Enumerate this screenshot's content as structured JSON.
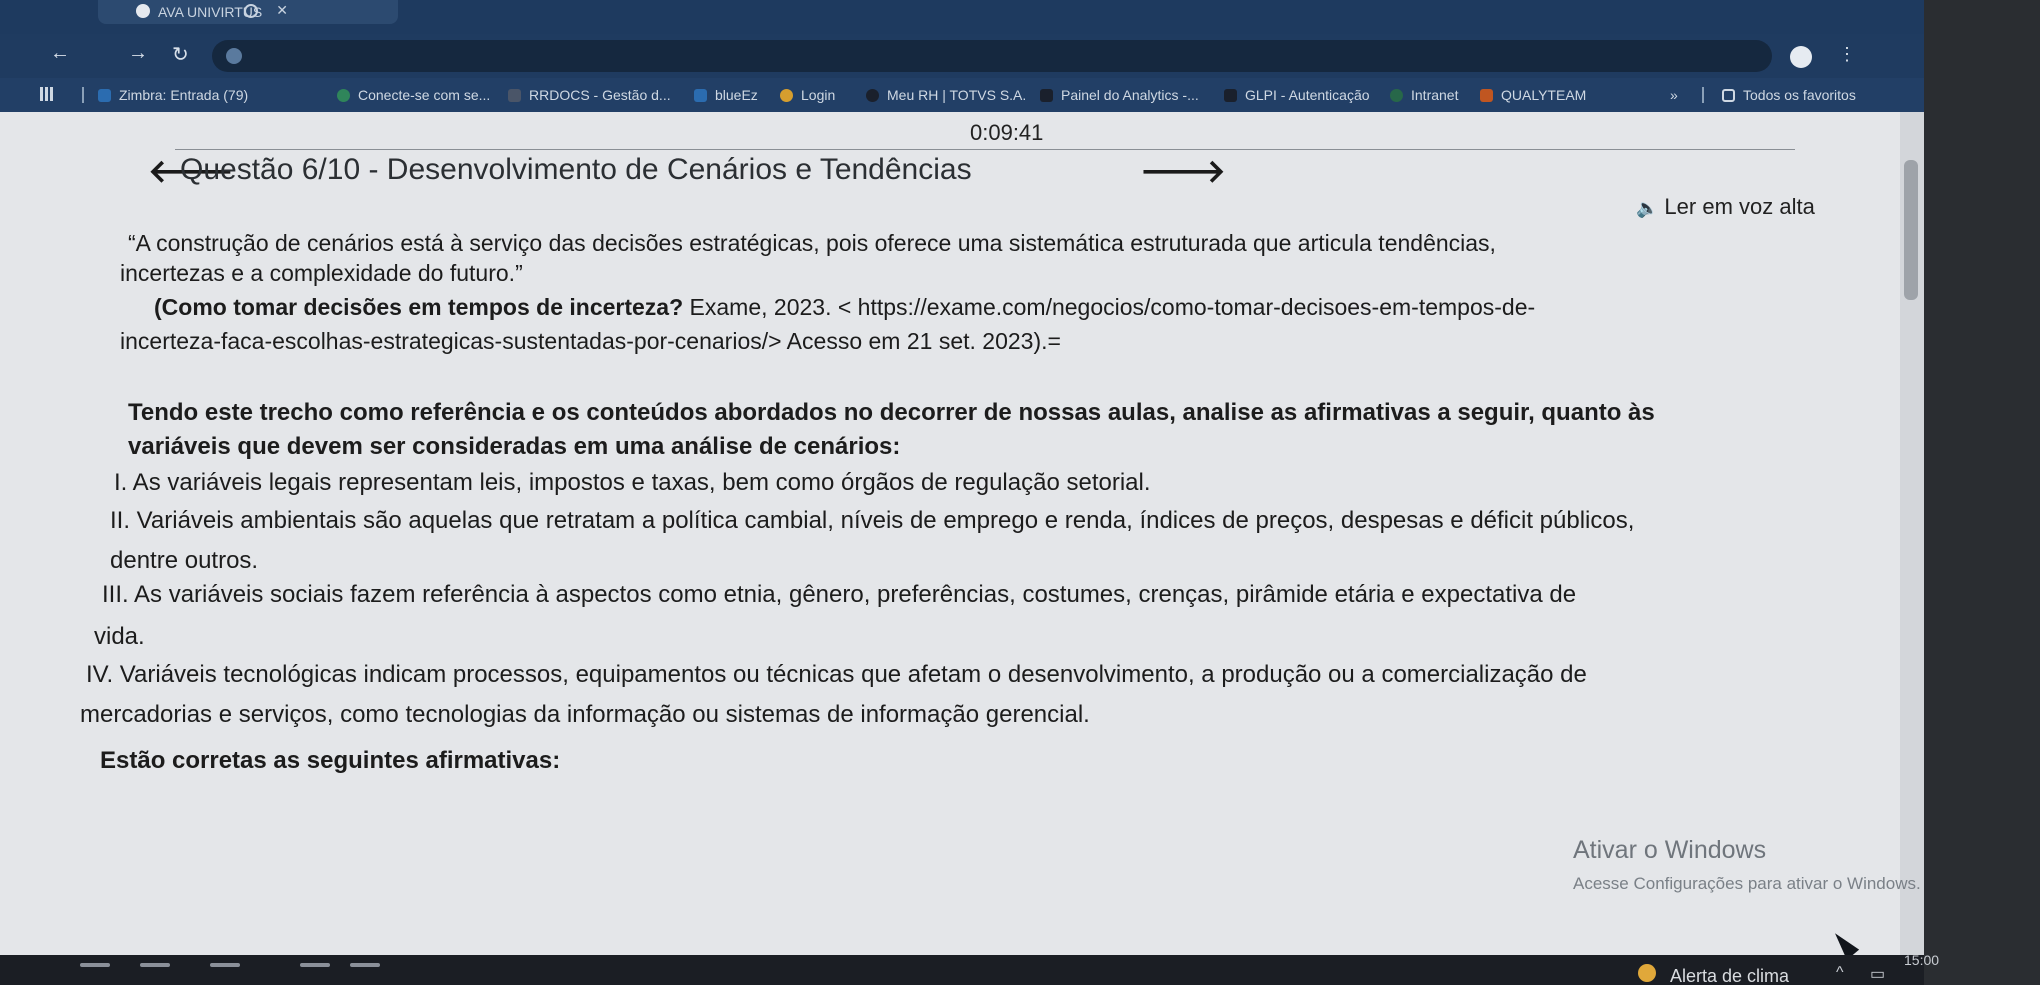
{
  "browser": {
    "tab_title": "AVA UNIVIRTUS",
    "bookmarks": [
      {
        "label": "Zimbra: Entrada (79)",
        "color": "#2b6cb0"
      },
      {
        "label": "Conecte-se com se...",
        "color": "#2f855a"
      },
      {
        "label": "RRDOCS - Gestão d...",
        "color": "#4a5568"
      },
      {
        "label": "blueEz",
        "color": "#2b6cb0"
      },
      {
        "label": "Login",
        "color": "#d69e2e"
      },
      {
        "label": "Meu RH | TOTVS S.A.",
        "color": "#1a202c"
      },
      {
        "label": "Painel do Analytics -...",
        "color": "#1a202c"
      },
      {
        "label": "GLPI - Autenticação",
        "color": "#1a202c"
      },
      {
        "label": "Intranet",
        "color": "#276749"
      },
      {
        "label": "QUALYTEAM",
        "color": "#c05621"
      }
    ],
    "all_bookmarks_label": "Todos os favoritos"
  },
  "quiz": {
    "timer": "0:09:41",
    "title": "Questão 6/10 - Desenvolvimento de Cenários e Tendências",
    "read_aloud": "Ler em voz alta",
    "quote_line1": "“A construção de cenários está à serviço das decisões estratégicas, pois oferece uma sistemática estruturada que articula tendências,",
    "quote_line2": "incertezas e a complexidade do futuro.”",
    "source_bold": "(Como tomar decisões em tempos de incerteza?",
    "source_rest": " Exame, 2023. < https://exame.com/negocios/como-tomar-decisoes-em-tempos-de-",
    "source_line2": "incerteza-faca-escolhas-estrategicas-sustentadas-por-cenarios/> Acesso em 21 set. 2023).=",
    "prompt_line1": "Tendo este trecho como referência e os conteúdos abordados no decorrer de nossas aulas, analise as afirmativas a seguir, quanto às",
    "prompt_line2": "variáveis que devem ser consideradas em uma análise de cenários:",
    "item1": "I. As variáveis legais representam leis, impostos e taxas, bem como órgãos de regulação setorial.",
    "item2_line1": "II. Variáveis ambientais são aquelas que retratam a política cambial, níveis de emprego e renda, índices de preços, despesas e déficit públicos,",
    "item2_line2": "dentre outros.",
    "item3_line1": "III. As variáveis sociais fazem referência à aspectos como etnia, gênero, preferências, costumes, crenças, pirâmide etária e expectativa de",
    "item3_line2": "vida.",
    "item4_line1": "IV. Variáveis tecnológicas indicam processos, equipamentos ou técnicas que afetam o desenvolvimento, a produção ou a comercialização de",
    "item4_line2": "mercadorias e serviços, como tecnologias da informação ou sistemas de informação gerencial.",
    "conclusion": "Estão corretas as seguintes afirmativas:"
  },
  "windows": {
    "activate_title": "Ativar o Windows",
    "activate_sub": "Acesse Configurações para ativar o Windows.",
    "clock": "15:00",
    "weather": "Alerta de clima"
  }
}
